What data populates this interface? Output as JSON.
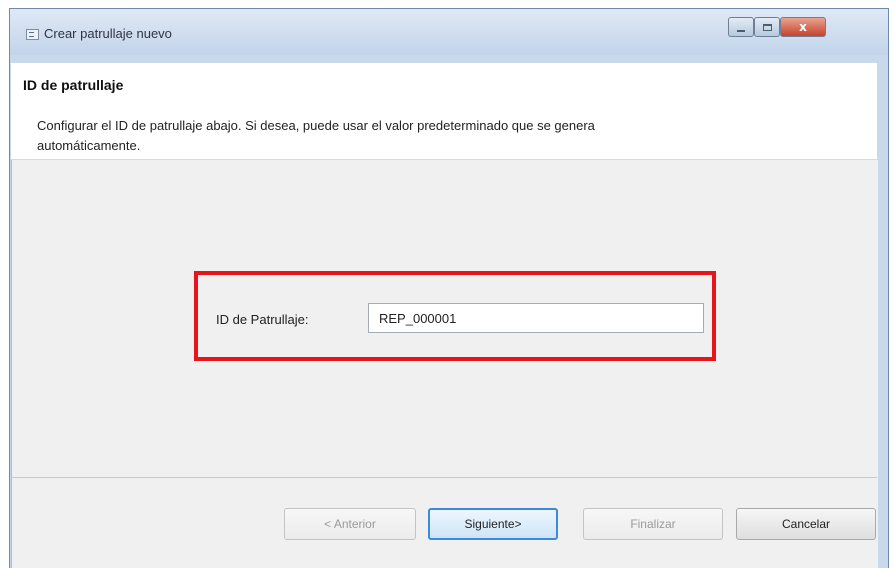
{
  "window": {
    "title": "Crear patrullaje nuevo",
    "controls": {
      "close": "x"
    }
  },
  "header": {
    "title": "ID de patrullaje",
    "description": "Configurar el ID de patrullaje abajo. Si desea, puede usar el valor predeterminado que se genera automáticamente."
  },
  "form": {
    "patrol_id_label": "ID de Patrullaje:",
    "patrol_id_value": "REP_000001"
  },
  "buttons": {
    "back": "< Anterior",
    "next": "Siguiente>",
    "finish": "Finalizar",
    "cancel": "Cancelar"
  },
  "colors": {
    "highlight": "#e8141b",
    "primary_focus": "#3c8ad8"
  }
}
